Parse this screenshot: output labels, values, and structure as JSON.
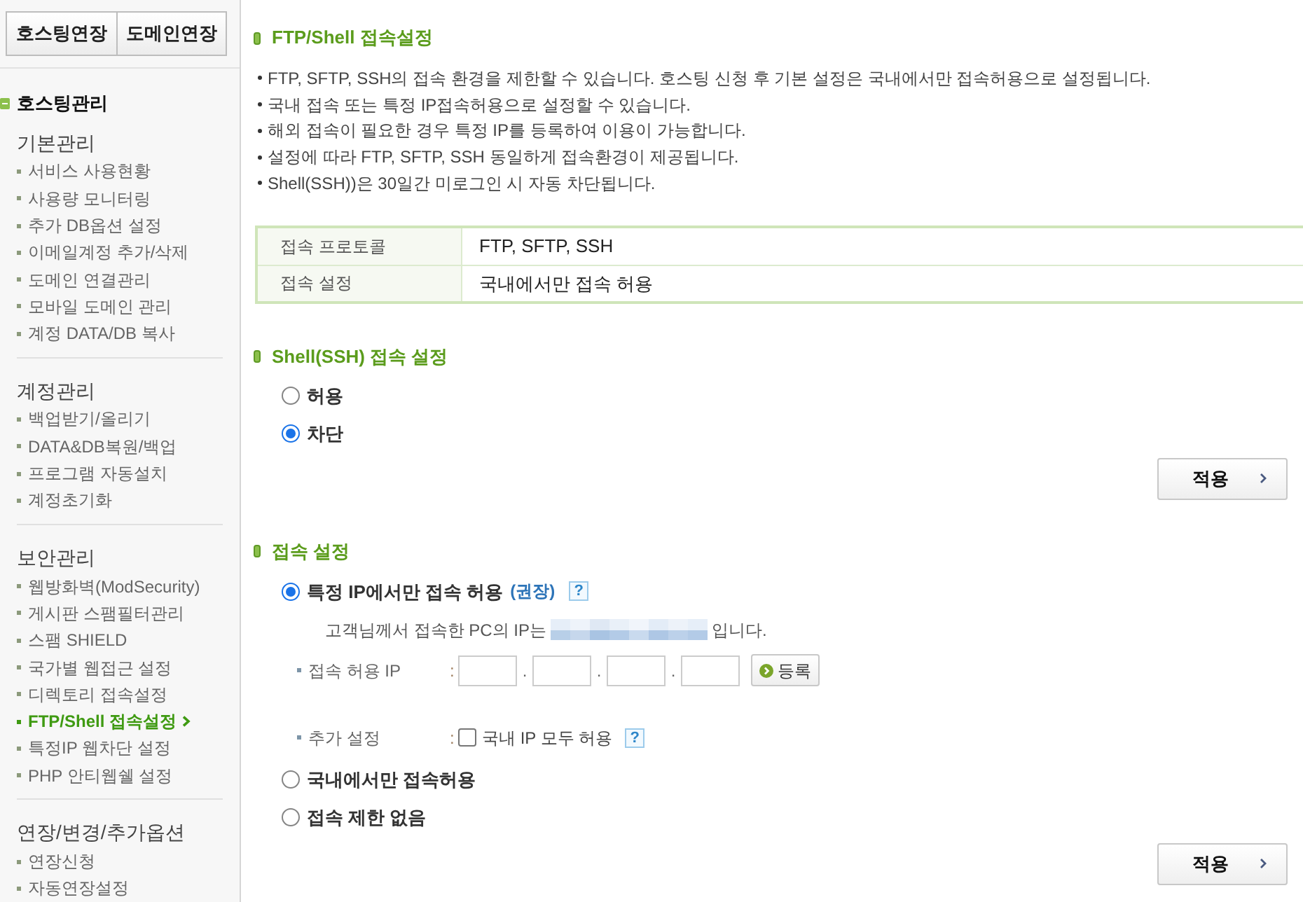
{
  "sidebar": {
    "top_buttons": [
      "호스팅연장",
      "도메인연장"
    ],
    "section": {
      "title": "호스팅관리",
      "expanded": true
    },
    "groups": [
      {
        "title": "기본관리",
        "items": [
          {
            "label": "서비스 사용현황",
            "selected": false
          },
          {
            "label": "사용량 모니터링",
            "selected": false
          },
          {
            "label": "추가 DB옵션 설정",
            "selected": false
          },
          {
            "label": "이메일계정 추가/삭제",
            "selected": false
          },
          {
            "label": "도메인 연결관리",
            "selected": false
          },
          {
            "label": "모바일 도메인 관리",
            "selected": false
          },
          {
            "label": "계정 DATA/DB 복사",
            "selected": false
          }
        ]
      },
      {
        "title": "계정관리",
        "items": [
          {
            "label": "백업받기/올리기",
            "selected": false
          },
          {
            "label": "DATA&DB복원/백업",
            "selected": false
          },
          {
            "label": "프로그램 자동설치",
            "selected": false
          },
          {
            "label": "계정초기화",
            "selected": false
          }
        ]
      },
      {
        "title": "보안관리",
        "items": [
          {
            "label": "웹방화벽(ModSecurity)",
            "selected": false
          },
          {
            "label": "게시판 스팸필터관리",
            "selected": false
          },
          {
            "label": "스팸 SHIELD",
            "selected": false
          },
          {
            "label": "국가별 웹접근 설정",
            "selected": false
          },
          {
            "label": "디렉토리 접속설정",
            "selected": false
          },
          {
            "label": "FTP/Shell 접속설정",
            "selected": true
          },
          {
            "label": "특정IP 웹차단 설정",
            "selected": false
          },
          {
            "label": "PHP 안티웹쉘 설정",
            "selected": false
          }
        ]
      },
      {
        "title": "연장/변경/추가옵션",
        "items": [
          {
            "label": "연장신청",
            "selected": false
          },
          {
            "label": "자동연장설정",
            "selected": false
          }
        ]
      }
    ]
  },
  "main": {
    "title": "FTP/Shell 접속설정",
    "notes": [
      "FTP, SFTP, SSH의 접속 환경을 제한할 수 있습니다. 호스팅 신청 후 기본 설정은 국내에서만 접속허용으로 설정됩니다.",
      "국내 접속 또는 특정 IP접속허용으로 설정할 수 있습니다.",
      "해외 접속이 필요한 경우 특정 IP를 등록하여 이용이 가능합니다.",
      "설정에 따라 FTP, SFTP, SSH 동일하게 접속환경이 제공됩니다.",
      "Shell(SSH))은 30일간 미로그인 시 자동 차단됩니다."
    ],
    "info_table": [
      {
        "label": "접속 프로토콜",
        "value": "FTP, SFTP, SSH"
      },
      {
        "label": "접속 설정",
        "value": "국내에서만 접속 허용"
      }
    ],
    "shell_setting": {
      "title": "Shell(SSH) 접속 설정",
      "options": [
        {
          "label": "허용",
          "selected": false
        },
        {
          "label": "차단",
          "selected": true
        }
      ],
      "apply_button": "적용"
    },
    "access_setting": {
      "title": "접속 설정",
      "options": [
        {
          "kind": "specific_ip",
          "label": "특정 IP에서만 접속 허용",
          "recommend": "(권장)",
          "help": "?",
          "selected": true,
          "ip_notice_before": "고객님께서 접속한 PC의 IP는",
          "ip_notice_after": "입니다.",
          "allowed_ip": {
            "label": "접속 허용 IP",
            "colon": ":",
            "separators": [
              ".",
              ".",
              "."
            ],
            "register_button": "등록"
          },
          "extra": {
            "label": "추가 설정",
            "colon": ":",
            "checkbox_label": "국내 IP 모두 허용",
            "checked": false,
            "help": "?"
          }
        },
        {
          "kind": "plain",
          "label": "국내에서만 접속허용",
          "selected": false
        },
        {
          "kind": "plain",
          "label": "접속 제한 없음",
          "selected": false
        }
      ],
      "apply_button": "적용"
    }
  }
}
